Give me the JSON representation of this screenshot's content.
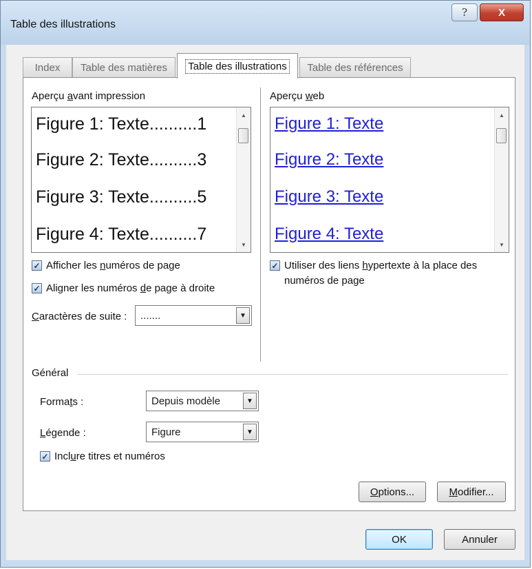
{
  "window": {
    "title": "Table des illustrations",
    "help_glyph": "?",
    "close_glyph": "X"
  },
  "tabs": [
    {
      "label": "Index"
    },
    {
      "label": "Table des matières"
    },
    {
      "label": "Table des illustrations",
      "active": true
    },
    {
      "label": "Table des références"
    }
  ],
  "print_preview": {
    "label_pre": "Aperçu ",
    "label_mnemonic": "a",
    "label_post": "vant impression",
    "lines": [
      "Figure 1: Texte..........1",
      "Figure 2: Texte..........3",
      "Figure 3: Texte..........5",
      "Figure 4: Texte..........7"
    ]
  },
  "web_preview": {
    "label_pre": "Aperçu ",
    "label_mnemonic": "w",
    "label_post": "eb",
    "lines": [
      "Figure 1: Texte",
      "Figure 2: Texte",
      "Figure 3: Texte",
      "Figure 4: Texte"
    ]
  },
  "options": {
    "show_page_numbers": {
      "pre": "Afficher les ",
      "mnemonic": "n",
      "post": "uméros de page",
      "checked": true
    },
    "align_right": {
      "pre": "Aligner les numéros ",
      "mnemonic": "d",
      "post": "e page à droite",
      "checked": true
    },
    "leader": {
      "pre": "",
      "mnemonic": "C",
      "post": "aractères de suite :",
      "value": "......."
    },
    "hyperlinks": {
      "pre": "Utiliser des liens ",
      "mnemonic": "h",
      "post": "ypertexte à la place des",
      "line2": "numéros de page",
      "checked": true
    }
  },
  "general": {
    "heading": "Général",
    "formats": {
      "pre": "Forma",
      "mnemonic": "t",
      "post": "s :",
      "value": "Depuis modèle"
    },
    "caption": {
      "pre": "",
      "mnemonic": "L",
      "post": "égende :",
      "value": "Figure"
    },
    "include": {
      "pre": "Incl",
      "mnemonic": "u",
      "post": "re titres et numéros",
      "checked": true
    }
  },
  "buttons": {
    "options": {
      "mnemonic": "O",
      "post": "ptions..."
    },
    "modify": {
      "mnemonic": "M",
      "post": "odifier..."
    },
    "ok": "OK",
    "cancel": "Annuler"
  },
  "icons": {
    "checkmark": "✓",
    "dropdown": "▼",
    "scroll_up": "▲",
    "scroll_down": "▼"
  }
}
